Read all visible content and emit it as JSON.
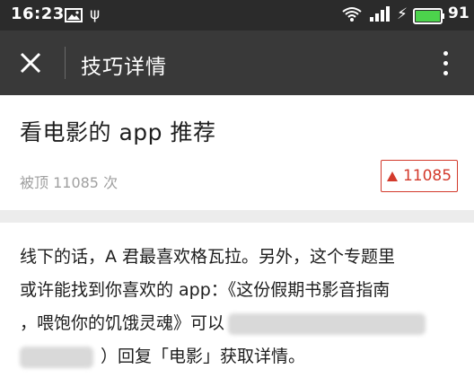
{
  "status_bar": {
    "time": "16:23",
    "battery_percent": "91",
    "icons": [
      "image-icon",
      "usb-icon",
      "wifi-icon",
      "signal-icon",
      "charging-icon",
      "battery-icon"
    ]
  },
  "toolbar": {
    "title": "技巧详情"
  },
  "header": {
    "title": "看电影的 app 推荐",
    "meta": "被顶 11085 次",
    "upvote_count": "11085"
  },
  "body": {
    "line1": "线下的话，A 君最喜欢格瓦拉。另外，这个专题里",
    "line2": "或许能找到你喜欢的 app：《这份假期书影音指南",
    "line3": "，喂饱你的饥饿灵魂》可以",
    "line4": "）回复「电影」获取详情。"
  },
  "colors": {
    "status_bar": "#2b2b2b",
    "toolbar": "#393939",
    "accent_red": "#d33a2c",
    "battery_green": "#4cd34c"
  }
}
